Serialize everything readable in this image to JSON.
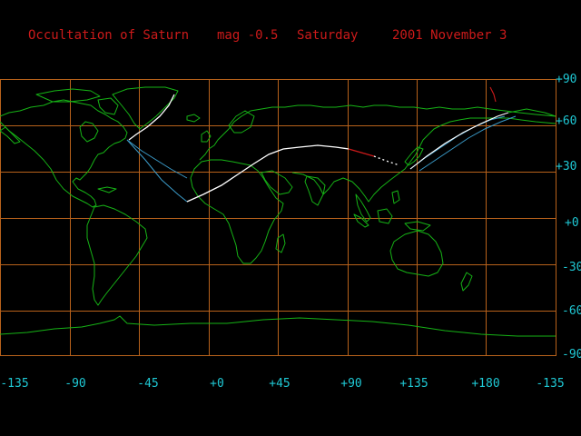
{
  "title": {
    "event": "Occultation of Saturn",
    "magnitude": "mag -0.5",
    "weekday": "Saturday",
    "date": "2001 November 3"
  },
  "latitude_labels": [
    "+90",
    "+60",
    "+30",
    "+0",
    "-30",
    "-60",
    "-90"
  ],
  "longitude_labels": [
    "-135",
    "-90",
    "-45",
    "+0",
    "+45",
    "+90",
    "+135",
    "+180",
    "-135"
  ],
  "colors": {
    "background": "#000000",
    "title": "#cc1a1a",
    "axis_labels": "#1fc8d4",
    "grid": "#b8621b",
    "coastline": "#16b316",
    "path_daylight": "#ffffff",
    "path_twilight": "#cc1a1a",
    "limit_lines": "#3a9ac8"
  }
}
